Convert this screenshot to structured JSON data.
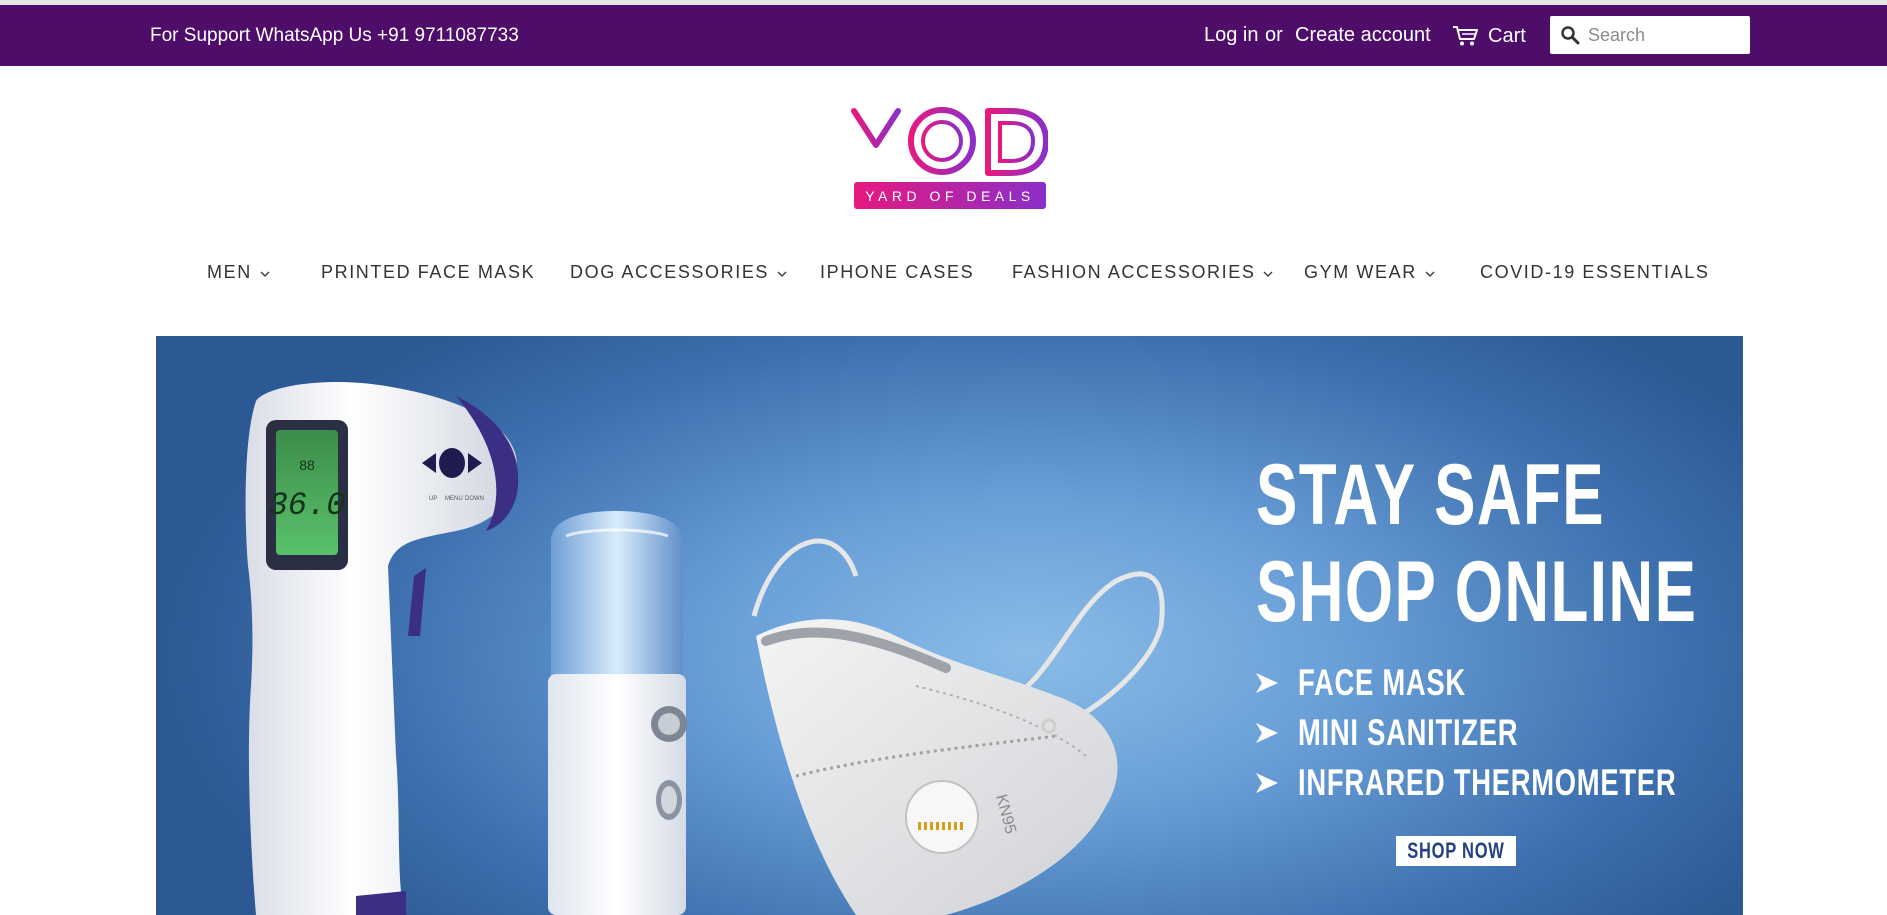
{
  "topbar": {
    "support_text": "For Support WhatsApp Us +91 9711087733",
    "login_label": "Log in",
    "or_label": "or",
    "create_account_label": "Create account",
    "cart_label": "Cart",
    "cart_icon": "cart-icon",
    "search_placeholder": "Search",
    "search_value": "",
    "search_icon": "search-icon",
    "background_color": "#4e0d68"
  },
  "logo": {
    "letters": "YOD",
    "tagline": "YARD OF DEALS",
    "colors": [
      "#e6197f",
      "#8b2fc9"
    ]
  },
  "nav": {
    "items": [
      {
        "label": "MEN",
        "has_dropdown": true
      },
      {
        "label": "PRINTED FACE MASK",
        "has_dropdown": false
      },
      {
        "label": "DOG ACCESSORIES",
        "has_dropdown": true
      },
      {
        "label": "IPHONE CASES",
        "has_dropdown": false
      },
      {
        "label": "FASHION ACCESSORIES",
        "has_dropdown": true
      },
      {
        "label": "GYM WEAR",
        "has_dropdown": true
      },
      {
        "label": "COVID-19 ESSENTIALS",
        "has_dropdown": false
      }
    ]
  },
  "banner": {
    "headline_1": "STAY SAFE",
    "headline_2": "SHOP ONLINE",
    "bullets": [
      "FACE MASK",
      "MINI SANITIZER",
      "INFRARED THERMOMETER"
    ],
    "cta_label": "SHOP NOW",
    "thermometer_reading": "36.0",
    "thermometer_top_reading": "88",
    "thermometer_buttons": [
      "UP",
      "MENU",
      "DOWN"
    ],
    "mask_print": "KN95"
  }
}
